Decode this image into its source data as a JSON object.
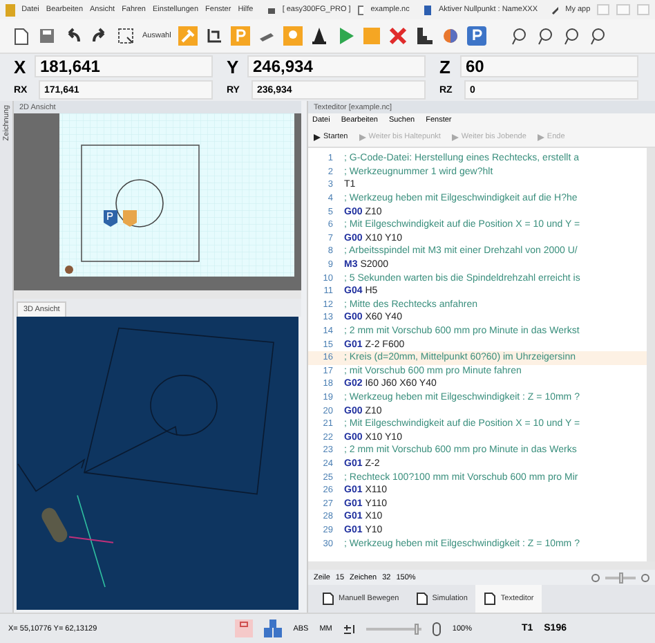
{
  "title_bar": {
    "menu": [
      "Datei",
      "Bearbeiten",
      "Ansicht",
      "Fahren",
      "Einstellungen",
      "Fenster",
      "Hilfe"
    ],
    "machine": "[ easy300FG_PRO ]",
    "file": "example.nc",
    "zero_point": "Aktiver Nullpunkt : NameXXX",
    "app": "My app"
  },
  "toolbar": {
    "select_label": "Auswahl"
  },
  "coordinates": [
    {
      "axis": "X",
      "value": "181,641"
    },
    {
      "axis": "Y",
      "value": "246,934"
    },
    {
      "axis": "Z",
      "value": "60"
    }
  ],
  "relative_coordinates": [
    {
      "axis": "RX",
      "value": "171,641"
    },
    {
      "axis": "RY",
      "value": "236,934"
    },
    {
      "axis": "RZ",
      "value": "0"
    }
  ],
  "side_tab": "Zeichnung",
  "view_2d": {
    "title": "2D Ansicht"
  },
  "view_3d": {
    "tab": "3D Ansicht"
  },
  "editor": {
    "title": "Texteditor [example.nc]",
    "menu": [
      "Datei",
      "Bearbeiten",
      "Suchen",
      "Fenster"
    ],
    "actions": [
      {
        "label": "Starten",
        "disabled": false
      },
      {
        "label": "Weiter bis Haltepunkt",
        "disabled": true
      },
      {
        "label": "Weiter bis Jobende",
        "disabled": true
      },
      {
        "label": "Ende",
        "disabled": true
      }
    ],
    "lines": [
      {
        "n": "1",
        "kind": "comment",
        "text": "; G-Code-Datei: Herstellung eines Rechtecks, erstellt a",
        "current": false
      },
      {
        "n": "2",
        "kind": "comment",
        "text": "; Werkzeugnummer 1 wird gew?hlt",
        "current": false
      },
      {
        "n": "3",
        "kind": "plain",
        "text": "T1",
        "current": false
      },
      {
        "n": "4",
        "kind": "comment",
        "text": "; Werkzeug heben mit Eilgeschwindigkeit auf die H?he",
        "current": false
      },
      {
        "n": "5",
        "kind": "command",
        "keyword": "G00",
        "text": "Z10",
        "current": false
      },
      {
        "n": "6",
        "kind": "comment",
        "text": "; Mit Eilgeschwindigkeit auf die Position X = 10 und Y =",
        "current": false
      },
      {
        "n": "7",
        "kind": "command",
        "keyword": "G00",
        "text": "X10 Y10",
        "current": false
      },
      {
        "n": "8",
        "kind": "comment",
        "text": "; Arbeitsspindel mit M3 mit einer Drehzahl von 2000 U/",
        "current": false
      },
      {
        "n": "9",
        "kind": "command",
        "keyword": "M3",
        "text": "S2000",
        "current": false
      },
      {
        "n": "10",
        "kind": "comment",
        "text": "; 5 Sekunden warten bis die Spindeldrehzahl erreicht is",
        "current": false
      },
      {
        "n": "11",
        "kind": "command",
        "keyword": "G04",
        "text": "H5",
        "current": false
      },
      {
        "n": "12",
        "kind": "comment",
        "text": "; Mitte des Rechtecks anfahren",
        "current": false
      },
      {
        "n": "13",
        "kind": "command",
        "keyword": "G00",
        "text": "X60 Y40",
        "current": false
      },
      {
        "n": "14",
        "kind": "comment",
        "text": "; 2 mm mit Vorschub 600 mm pro Minute in das Werkst",
        "current": false
      },
      {
        "n": "15",
        "kind": "command",
        "keyword": "G01",
        "text": "Z-2 F600",
        "current": false
      },
      {
        "n": "16",
        "kind": "comment",
        "text": "; Kreis (d=20mm, Mittelpunkt 60?60) im Uhrzeigersinn",
        "current": true
      },
      {
        "n": "17",
        "kind": "comment",
        "text": "; mit Vorschub 600 mm pro Minute fahren",
        "current": false
      },
      {
        "n": "18",
        "kind": "command",
        "keyword": "G02",
        "text": "I60 J60 X60 Y40",
        "current": false
      },
      {
        "n": "19",
        "kind": "comment",
        "text": "; Werkzeug heben mit Eilgeschwindigkeit : Z = 10mm ?",
        "current": false
      },
      {
        "n": "20",
        "kind": "command",
        "keyword": "G00",
        "text": "Z10",
        "current": false
      },
      {
        "n": "21",
        "kind": "comment",
        "text": "; Mit Eilgeschwindigkeit auf die Position X = 10 und Y =",
        "current": false
      },
      {
        "n": "22",
        "kind": "command",
        "keyword": "G00",
        "text": "X10 Y10",
        "current": false
      },
      {
        "n": "23",
        "kind": "comment",
        "text": "; 2 mm mit Vorschub 600 mm pro Minute in das Werks",
        "current": false
      },
      {
        "n": "24",
        "kind": "command",
        "keyword": "G01",
        "text": "Z-2",
        "current": false
      },
      {
        "n": "25",
        "kind": "comment",
        "text": "; Rechteck 100?100 mm mit Vorschub 600 mm pro Mir",
        "current": false
      },
      {
        "n": "26",
        "kind": "command",
        "keyword": "G01",
        "text": "X110",
        "current": false
      },
      {
        "n": "27",
        "kind": "command",
        "keyword": "G01",
        "text": "Y110",
        "current": false
      },
      {
        "n": "28",
        "kind": "command",
        "keyword": "G01",
        "text": "X10",
        "current": false
      },
      {
        "n": "29",
        "kind": "command",
        "keyword": "G01",
        "text": "Y10",
        "current": false
      },
      {
        "n": "30",
        "kind": "comment",
        "text": "; Werkzeug heben mit Eilgeschwindigkeit : Z = 10mm ?",
        "current": false
      }
    ],
    "status": {
      "line_label": "Zeile",
      "line": "15",
      "char_label": "Zeichen",
      "char": "32",
      "zoom": "150%",
      "zoom_slider": {
        "level": 0.5
      }
    }
  },
  "bottom_tabs": [
    {
      "label": "Manuell Bewegen",
      "selected": false
    },
    {
      "label": "Simulation",
      "selected": false
    },
    {
      "label": "Texteditor",
      "selected": true
    }
  ],
  "status_bar": {
    "position": "X= 55,10776 Y= 62,13129",
    "mode": "ABS",
    "unit": "MM",
    "feed_slider": {
      "level": 0.9
    },
    "override": "100%",
    "tool": "T1",
    "spindle": "S196"
  }
}
